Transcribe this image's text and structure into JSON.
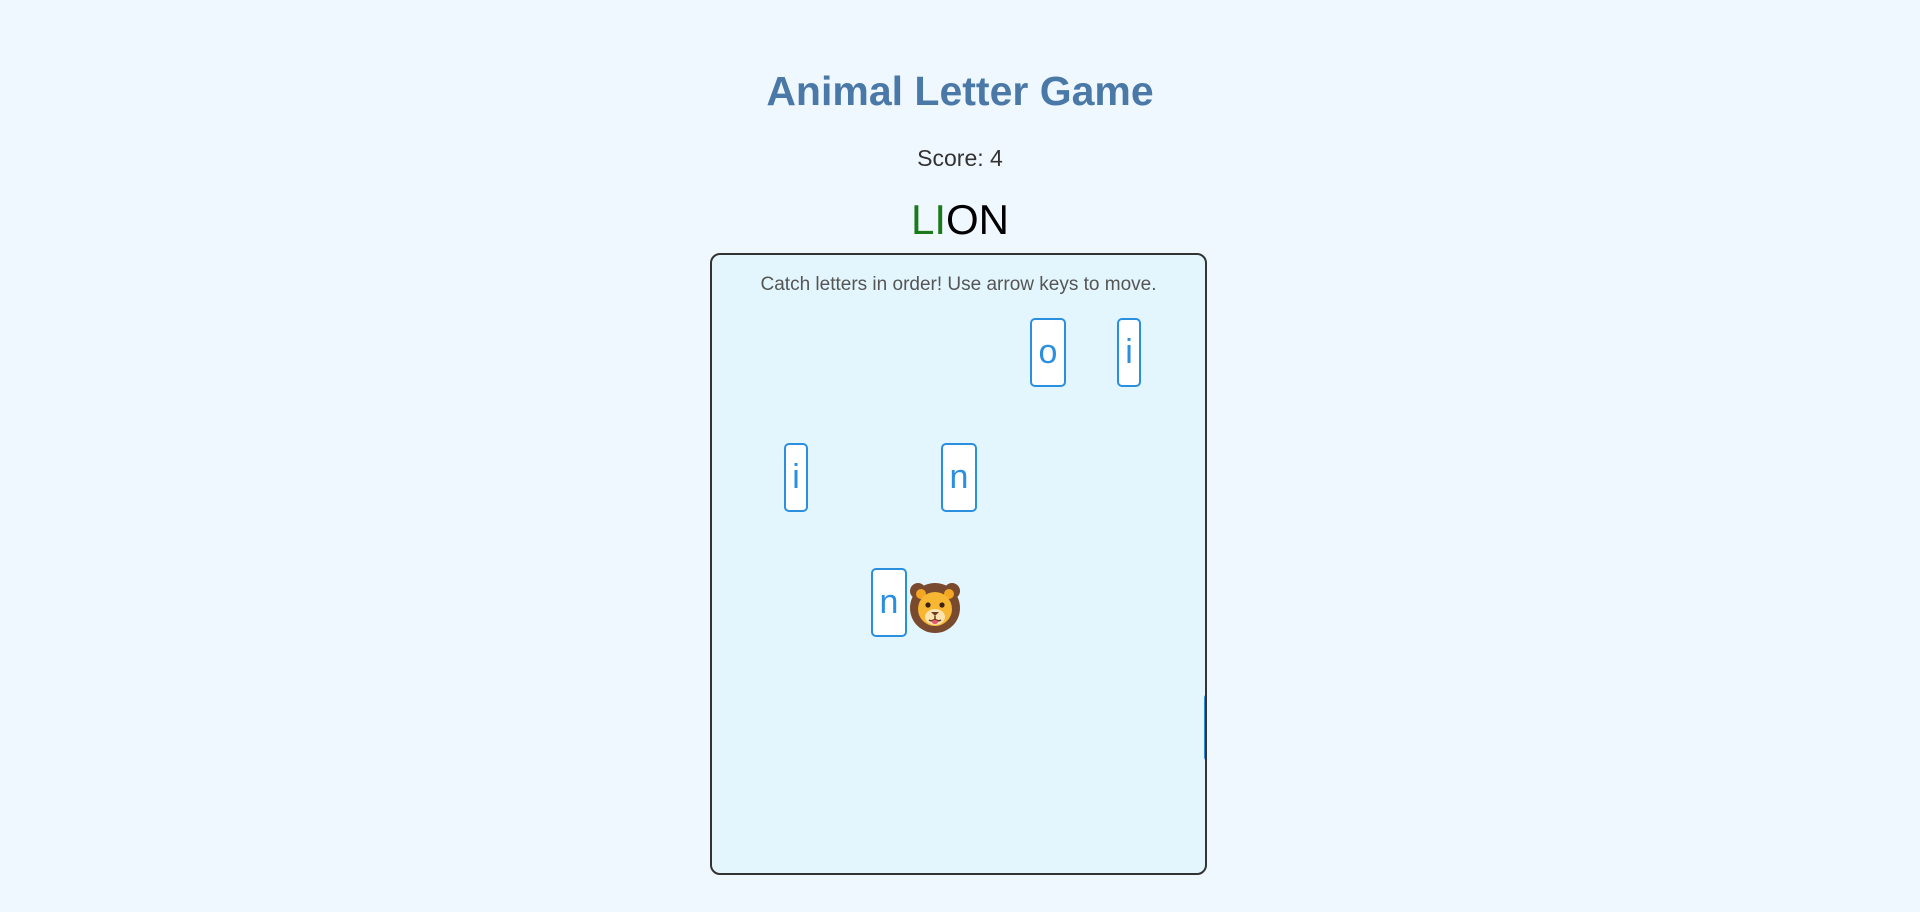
{
  "game": {
    "title": "Animal Letter Game",
    "score_text": "Score: 4",
    "target_word": {
      "caught": "LI",
      "remaining": "ON"
    },
    "instructions": "Catch letters in order! Use arrow keys to move.",
    "player_icon": "lion-face-icon",
    "falling_letters": [
      {
        "letter": "o"
      },
      {
        "letter": "i"
      },
      {
        "letter": "i"
      },
      {
        "letter": "n"
      },
      {
        "letter": "n"
      },
      {
        "letter": ""
      }
    ]
  },
  "colors": {
    "background": "#f0f8ff",
    "title": "#4a79a8",
    "board_fill": "#e4f6fd",
    "tile_accent": "#2b8fe0",
    "caught_letters": "#1a7a1a"
  }
}
